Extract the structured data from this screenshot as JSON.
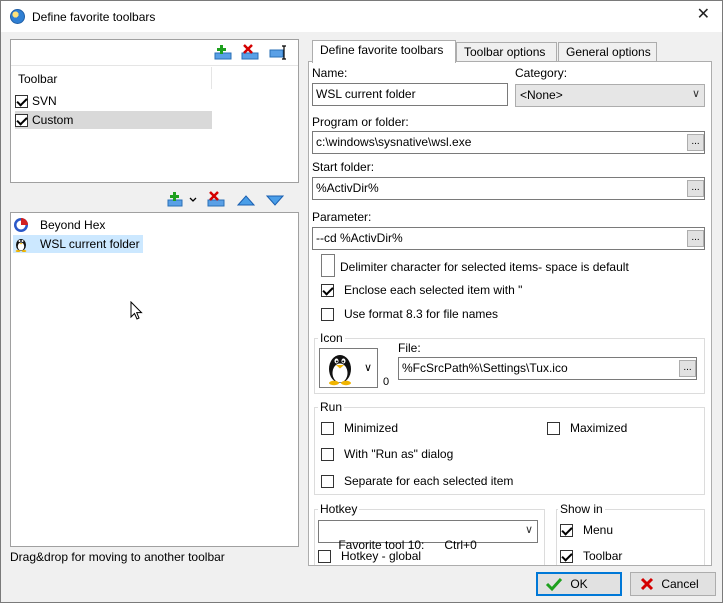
{
  "window": {
    "title": "Define favorite toolbars",
    "close_glyph": "✕"
  },
  "toolbar_list": {
    "header": "Toolbar",
    "items": [
      {
        "label": "SVN",
        "checked": true
      },
      {
        "label": "Custom",
        "checked": true,
        "selected": true
      }
    ]
  },
  "button_list": {
    "items": [
      {
        "label": "Beyond Hex",
        "icon": "beyond-hex-icon"
      },
      {
        "label": "WSL current folder",
        "icon": "tux-icon",
        "selected": true
      }
    ]
  },
  "status_text": "Drag&drop for moving to another toolbar",
  "tabs": [
    {
      "label": "Define favorite toolbars",
      "active": true
    },
    {
      "label": "Toolbar options",
      "active": false
    },
    {
      "label": "General options",
      "active": false
    }
  ],
  "form": {
    "name_label": "Name:",
    "name_value": "WSL current folder",
    "category_label": "Category:",
    "category_value": "<None>",
    "program_label": "Program or folder:",
    "program_value": "c:\\windows\\sysnative\\wsl.exe",
    "start_label": "Start folder:",
    "start_value": "%ActivDir%",
    "param_label": "Parameter:",
    "param_value": "--cd %ActivDir%",
    "browse_glyph": "...",
    "delimiter_label": "Delimiter character for selected items- space is default",
    "enclose_label": "Enclose each selected item with \"",
    "enclose_checked": true,
    "format83_label": "Use format 8.3 for file names",
    "format83_checked": false
  },
  "icon_group": {
    "title": "Icon",
    "file_label": "File:",
    "file_value": "%FcSrcPath%\\Settings\\Tux.ico",
    "index": "0"
  },
  "run_group": {
    "title": "Run",
    "minimized": "Minimized",
    "maximized": "Maximized",
    "run_as": "With \"Run as\" dialog",
    "separate": "Separate for each selected item"
  },
  "hotkey_group": {
    "title": "Hotkey",
    "value": "Favorite tool 10:      Ctrl+0",
    "global_label": "Hotkey - global"
  },
  "show_in_group": {
    "title": "Show in",
    "menu": "Menu",
    "toolbar": "Toolbar"
  },
  "buttons": {
    "ok": "OK",
    "cancel": "Cancel"
  },
  "colors": {
    "accent": "#0078d7",
    "selection": "#cce8ff",
    "ok_check": "#1ea01e",
    "cancel_x": "#d40000"
  }
}
